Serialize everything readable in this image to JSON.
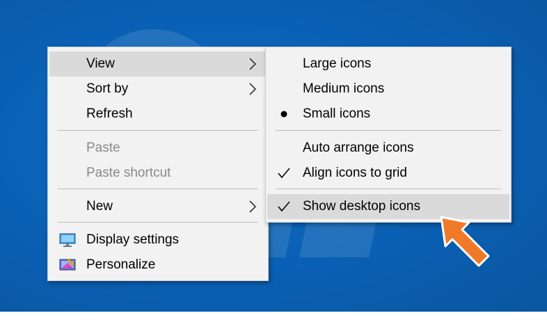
{
  "main_menu": {
    "items": [
      {
        "label": "View",
        "submenu": true,
        "highlighted": true
      },
      {
        "label": "Sort by",
        "submenu": true
      },
      {
        "label": "Refresh"
      },
      {
        "label": "Paste",
        "disabled": true
      },
      {
        "label": "Paste shortcut",
        "disabled": true
      },
      {
        "label": "New",
        "submenu": true
      },
      {
        "label": "Display settings",
        "icon": "display-settings-icon"
      },
      {
        "label": "Personalize",
        "icon": "personalize-icon"
      }
    ]
  },
  "view_submenu": {
    "items": [
      {
        "label": "Large icons"
      },
      {
        "label": "Medium icons"
      },
      {
        "label": "Small icons",
        "mark": "bullet"
      },
      {
        "label": "Auto arrange icons"
      },
      {
        "label": "Align icons to grid",
        "mark": "check"
      },
      {
        "label": "Show desktop icons",
        "mark": "check",
        "highlighted": true
      }
    ]
  },
  "colors": {
    "desktop_background": "#0b63b9",
    "menu_background": "#f2f2f2",
    "highlight": "#dadada",
    "disabled_text": "#8a8a8a",
    "pointer_arrow": "#f07a28"
  }
}
